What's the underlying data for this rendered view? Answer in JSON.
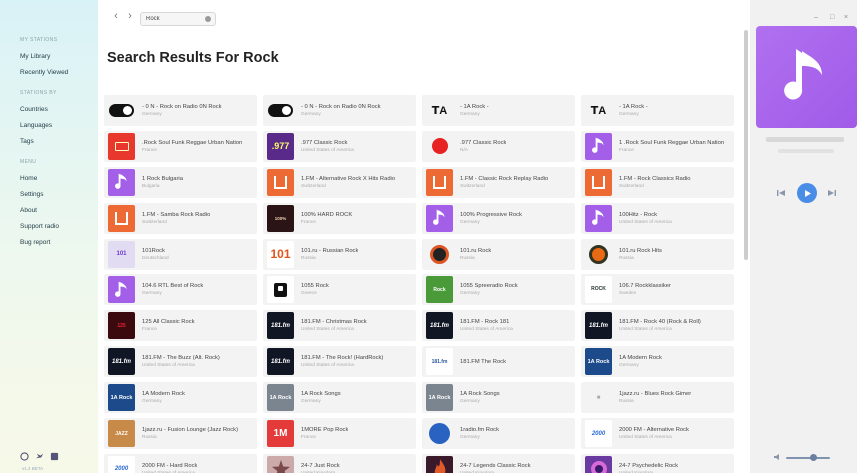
{
  "window_controls": [
    "–",
    "□",
    "×"
  ],
  "sidebar": {
    "sections": [
      {
        "title": "MY STATIONS",
        "items": [
          "My Library",
          "Recently Viewed"
        ]
      },
      {
        "title": "STATIONS BY",
        "items": [
          "Countries",
          "Languages",
          "Tags"
        ]
      },
      {
        "title": "MENU",
        "items": [
          "Home",
          "Settings",
          "About",
          "Support radio",
          "Bug report"
        ]
      }
    ],
    "footer": "v1.2 BETA"
  },
  "search": {
    "value": "Rock",
    "placeholder": "Search"
  },
  "nav": {
    "back": "‹",
    "forward": "›"
  },
  "page_title": "Search Results For Rock",
  "stations": [
    {
      "name": "- 0 N - Rock on Radio 0N Rock",
      "country": "Germany",
      "logo": "toggle"
    },
    {
      "name": "- 0 N - Rock on Radio 0N Rock",
      "country": "Germany",
      "logo": "toggle"
    },
    {
      "name": "- 1A Rock -",
      "country": "Germany",
      "logo": "ta"
    },
    {
      "name": "- 1A Rock -",
      "country": "Germany",
      "logo": "ta"
    },
    {
      "name": ".Rock Soul Funk Reggae Urban Nation",
      "country": "France",
      "logo": "red"
    },
    {
      "name": ".977 Classic Rock",
      "country": "United States of America",
      "logo": "977"
    },
    {
      "name": ".977 Classic Rock",
      "country": "N/A",
      "logo": "dot"
    },
    {
      "name": "1 .Rock Soul Funk Reggae Urban Nation",
      "country": "France",
      "logo": "purple"
    },
    {
      "name": "1 Rock Bulgaria",
      "country": "Bulgaria",
      "logo": "purple"
    },
    {
      "name": "1.FM - Alternative Rock X Hits Radio",
      "country": "Switzerland",
      "logo": "orange"
    },
    {
      "name": "1.FM - Classic Rock Replay Radio",
      "country": "Switzerland",
      "logo": "orange"
    },
    {
      "name": "1.FM - Rock Classics Radio",
      "country": "Switzerland",
      "logo": "orange"
    },
    {
      "name": "1.FM - Samba Rock Radio",
      "country": "Switzerland",
      "logo": "orange"
    },
    {
      "name": "100% HARD ROCK",
      "country": "France",
      "logo": "dark"
    },
    {
      "name": "100% Progressive Rock",
      "country": "Germany",
      "logo": "purple"
    },
    {
      "name": "100Hitz - Rock",
      "country": "United States of America",
      "logo": "purple"
    },
    {
      "name": "101Rock",
      "country": "Deutschland",
      "logo": "lavender"
    },
    {
      "name": "101.ru - Russian Rock",
      "country": "Russia",
      "logo": "101"
    },
    {
      "name": "101.ru Rock",
      "country": "Russia",
      "logo": "disc"
    },
    {
      "name": "101.ru Rock Hits",
      "country": "Russia",
      "logo": "disc2"
    },
    {
      "name": "104.6 RTL Best of Rock",
      "country": "Germany",
      "logo": "purple"
    },
    {
      "name": "1055 Rock",
      "country": "Greece",
      "logo": "blk"
    },
    {
      "name": "1055 Spreeradio Rock",
      "country": "Germany",
      "logo": "green"
    },
    {
      "name": "106.7 Rockklassiker",
      "country": "Sweden",
      "logo": "rockcl"
    },
    {
      "name": "125 All Classic Rock",
      "country": "France",
      "logo": "mag"
    },
    {
      "name": "181.FM - Christmas Rock",
      "country": "United States of America",
      "logo": "181"
    },
    {
      "name": "181.FM - Rock 181",
      "country": "United States of America",
      "logo": "181"
    },
    {
      "name": "181.FM - Rock 40 (Rock & Roll)",
      "country": "United States of America",
      "logo": "181"
    },
    {
      "name": "181.FM - The Buzz (Alt. Rock)",
      "country": "United States of America",
      "logo": "181"
    },
    {
      "name": "181.FM - The Rock! (HardRock)",
      "country": "United States of America",
      "logo": "181"
    },
    {
      "name": "181.FM The Rock",
      "country": "",
      "logo": "181w"
    },
    {
      "name": "1A Modern Rock",
      "country": "Germany",
      "logo": "1a"
    },
    {
      "name": "1A Modern Rock",
      "country": "Germany",
      "logo": "1a"
    },
    {
      "name": "1A Rock Songs",
      "country": "Germany",
      "logo": "1agrey"
    },
    {
      "name": "1A Rock Songs",
      "country": "Germany",
      "logo": "1agrey"
    },
    {
      "name": "1jazz.ru - Blues Rock Gimer",
      "country": "Russia",
      "logo": "light"
    },
    {
      "name": "1jazz.ru - Fusion Lounge (Jazz Rock)",
      "country": "Russia",
      "logo": "jazz"
    },
    {
      "name": "1MORE Pop Rock",
      "country": "France",
      "logo": "1m"
    },
    {
      "name": "1radio.fm Rock",
      "country": "Germany",
      "logo": "radio"
    },
    {
      "name": "2000 FM - Alternative Rock",
      "country": "United States of America",
      "logo": "2000"
    },
    {
      "name": "2000 FM - Hard Rock",
      "country": "United States of America",
      "logo": "2000"
    },
    {
      "name": "24-7 Just Rock",
      "country": "United Kingdom",
      "logo": "star"
    },
    {
      "name": "24-7 Legends Classic Rock",
      "country": "United Kingdom",
      "logo": "flame"
    },
    {
      "name": "24-7 Psychedelic Rock",
      "country": "United Kingdom",
      "logo": "psy"
    }
  ],
  "logo_text": {
    "977": ".977",
    "101": "101",
    "ta": "ꓔA",
    "dark": "100%",
    "lavender": "101",
    "green": "Rock",
    "rockcl": "ROCK",
    "mag": "125",
    "181": "181.fm",
    "181w": "181.fm",
    "1a": "1A Rock",
    "1agrey": "1A Rock",
    "light": "■",
    "jazz": "JAZZ",
    "1m": "1M",
    "2000": "2000",
    "orange": ".FM"
  },
  "player": {
    "playing": false
  }
}
